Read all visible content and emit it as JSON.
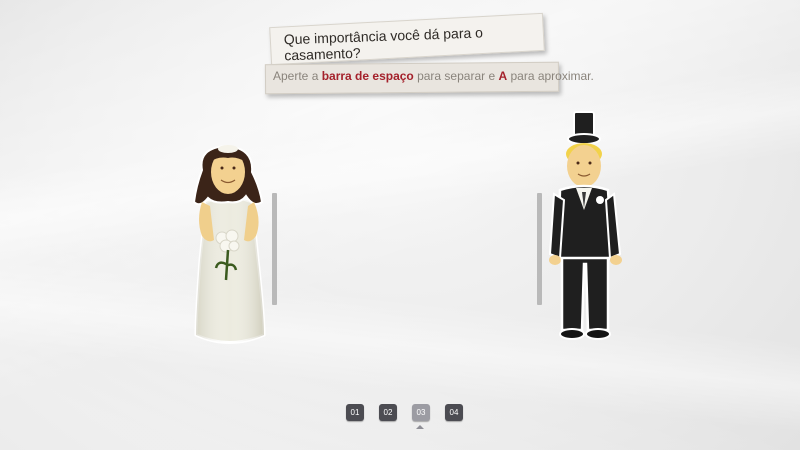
{
  "question": "Que importância você dá para o casamento?",
  "instruction": {
    "part1": "Aperte a ",
    "key1": "barra de espaço",
    "part2": " para separar e ",
    "key2": "A",
    "part3": " para aproximar."
  },
  "pages": [
    {
      "label": "01",
      "active": false
    },
    {
      "label": "02",
      "active": false
    },
    {
      "label": "03",
      "active": true
    },
    {
      "label": "04",
      "active": false
    }
  ],
  "colors": {
    "highlight": "#a4212b",
    "page_button": "#4c4c52",
    "page_button_active": "#9c9ca3"
  }
}
